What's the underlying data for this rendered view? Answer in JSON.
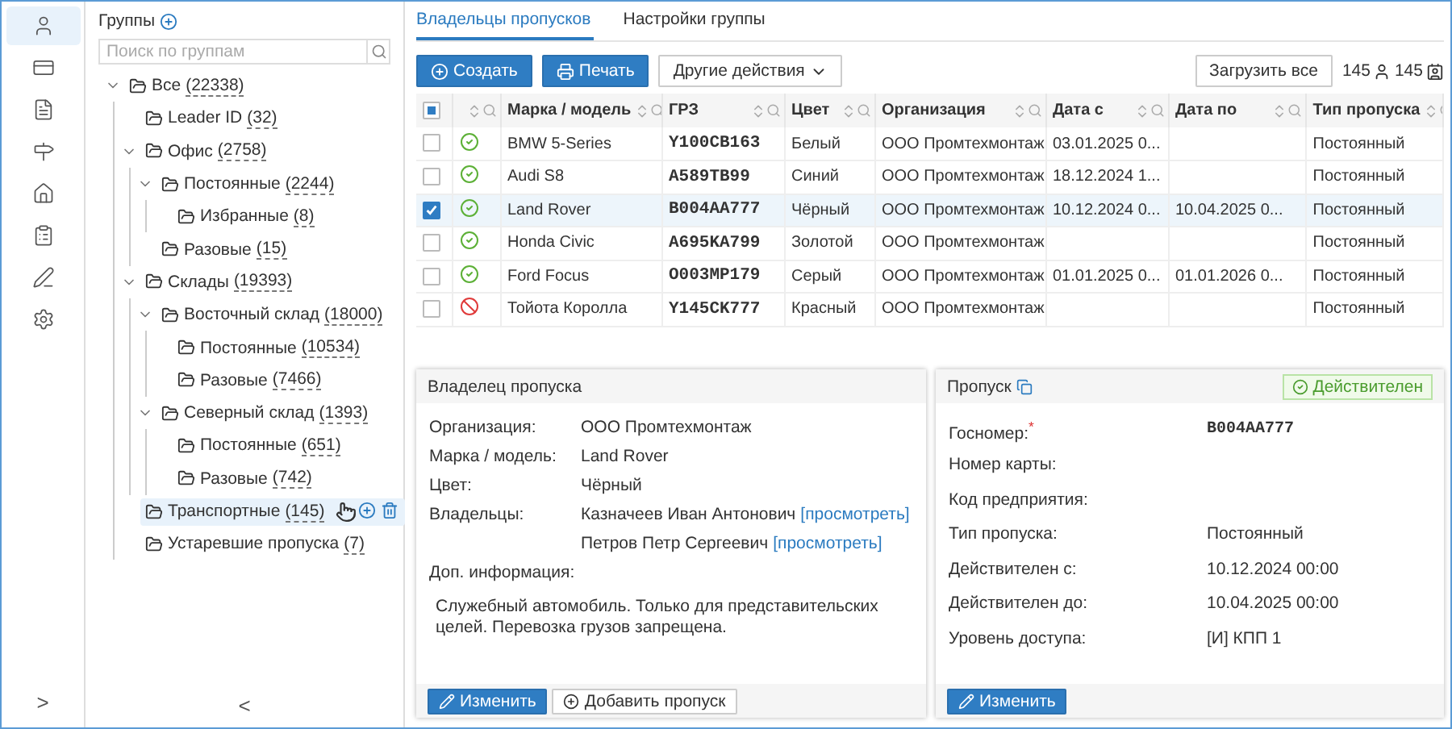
{
  "rail": {
    "items": [
      {
        "selected": true
      },
      {
        "selected": false
      },
      {
        "selected": false
      },
      {
        "selected": false
      },
      {
        "selected": false
      },
      {
        "selected": false
      },
      {
        "selected": false
      },
      {
        "selected": false
      }
    ],
    "expand": ">"
  },
  "groups": {
    "title": "Группы",
    "search": {
      "placeholder": "Поиск по группам"
    },
    "collapse": "<",
    "tree": [
      {
        "name": "Все",
        "count": "(22338)",
        "expanded": true,
        "selected": false,
        "children": [
          {
            "name": "Leader ID",
            "count": "(32)",
            "selected": false
          },
          {
            "name": "Офис",
            "count": "(2758)",
            "expanded": true,
            "selected": false,
            "children": [
              {
                "name": "Постоянные",
                "count": "(2244)",
                "expanded": true,
                "selected": false,
                "children": [
                  {
                    "name": "Избранные",
                    "count": "(8)",
                    "selected": false
                  }
                ]
              },
              {
                "name": "Разовые",
                "count": "(15)",
                "selected": false
              }
            ]
          },
          {
            "name": "Склады",
            "count": "(19393)",
            "expanded": true,
            "selected": false,
            "children": [
              {
                "name": "Восточный склад",
                "count": "(18000)",
                "expanded": true,
                "selected": false,
                "children": [
                  {
                    "name": "Постоянные",
                    "count": "(10534)",
                    "selected": false
                  },
                  {
                    "name": "Разовые",
                    "count": "(7466)",
                    "selected": false
                  }
                ]
              },
              {
                "name": "Северный склад",
                "count": "(1393)",
                "expanded": true,
                "selected": false,
                "children": [
                  {
                    "name": "Постоянные",
                    "count": "(651)",
                    "selected": false
                  },
                  {
                    "name": "Разовые",
                    "count": "(742)",
                    "selected": false
                  }
                ]
              }
            ]
          },
          {
            "name": "Транспортные",
            "count": "(145)",
            "selected": true
          },
          {
            "name": "Устаревшие пропуска",
            "count": "(7)",
            "selected": false
          }
        ]
      }
    ]
  },
  "tabs": [
    {
      "label": "Владельцы пропусков",
      "selected": true
    },
    {
      "label": "Настройки группы",
      "selected": false
    }
  ],
  "toolbar": {
    "create": "Создать",
    "print": "Печать",
    "more": "Другие действия",
    "load_all": "Загрузить все",
    "people_count": "145",
    "cards_count": "145"
  },
  "table": {
    "partially_selected": true,
    "columns": [
      "Марка / модель",
      "ГРЗ",
      "Цвет",
      "Организация",
      "Дата с",
      "Дата по",
      "Тип пропуска"
    ],
    "rows": [
      {
        "checked": false,
        "valid": true,
        "cells": [
          "BMW 5-Series",
          "Y100CB163",
          "Белый",
          "ООО Промтехмонтаж",
          "03.01.2025 0...",
          "",
          "Постоянный"
        ]
      },
      {
        "checked": false,
        "valid": true,
        "cells": [
          "Audi S8",
          "A589TB99",
          "Синий",
          "ООО Промтехмонтаж",
          "18.12.2024 1...",
          "",
          "Постоянный"
        ]
      },
      {
        "checked": true,
        "valid": true,
        "cells": [
          "Land Rover",
          "B004AA777",
          "Чёрный",
          "ООО Промтехмонтаж",
          "10.12.2024 0...",
          "10.04.2025 0...",
          "Постоянный"
        ]
      },
      {
        "checked": false,
        "valid": true,
        "cells": [
          "Honda Civic",
          "A695KA799",
          "Золотой",
          "ООО Промтехмонтаж",
          "",
          "",
          "Постоянный"
        ]
      },
      {
        "checked": false,
        "valid": true,
        "cells": [
          "Ford Focus",
          "O003MP179",
          "Серый",
          "ООО Промтехмонтаж",
          "01.01.2025 0...",
          "01.01.2026 0...",
          "Постоянный"
        ]
      },
      {
        "checked": false,
        "valid": false,
        "cells": [
          "Тойота Королла",
          "Y145CK777",
          "Красный",
          "ООО Промтехмонтаж",
          "",
          "",
          "Постоянный"
        ]
      }
    ]
  },
  "owner_panel": {
    "title": "Владелец пропуска",
    "fields": [
      {
        "label": "Организация:",
        "value": "ООО Промтехмонтаж"
      },
      {
        "label": "Марка / модель:",
        "value": "Land Rover"
      },
      {
        "label": "Цвет:",
        "value": "Чёрный"
      }
    ],
    "owners_label": "Владельцы:",
    "owners": [
      {
        "name": "Казначеев Иван Антонович",
        "link": "[просмотреть]"
      },
      {
        "name": "Петров Петр Сергеевич",
        "link": "[просмотреть]"
      }
    ],
    "info_label": "Доп. информация:",
    "info": "Служебный автомобиль. Только для представительских целей. Перевозка грузов запрещена.",
    "edit": "Изменить",
    "add": "Добавить пропуск"
  },
  "pass_panel": {
    "title": "Пропуск",
    "status": "Действителен",
    "valid": true,
    "fields": [
      {
        "label": "Госномер:$^{*}$",
        "value": "B004AA777",
        "kind": "plate"
      },
      {
        "label": "Номер карты:"
      },
      {
        "label": "Код предприятия:"
      },
      {
        "label": "Тип пропуска:",
        "value": "Постоянный",
        "kind": "text"
      },
      {
        "label": "Действителен с:",
        "value": "10.12.2024 00:00",
        "kind": "text"
      },
      {
        "label": "Действителен до:",
        "value": "10.04.2025 00:00",
        "kind": "text"
      },
      {
        "label": "Уровень доступа:",
        "value": "[И] КПП 1",
        "kind": "text"
      }
    ],
    "edit": "Изменить"
  }
}
